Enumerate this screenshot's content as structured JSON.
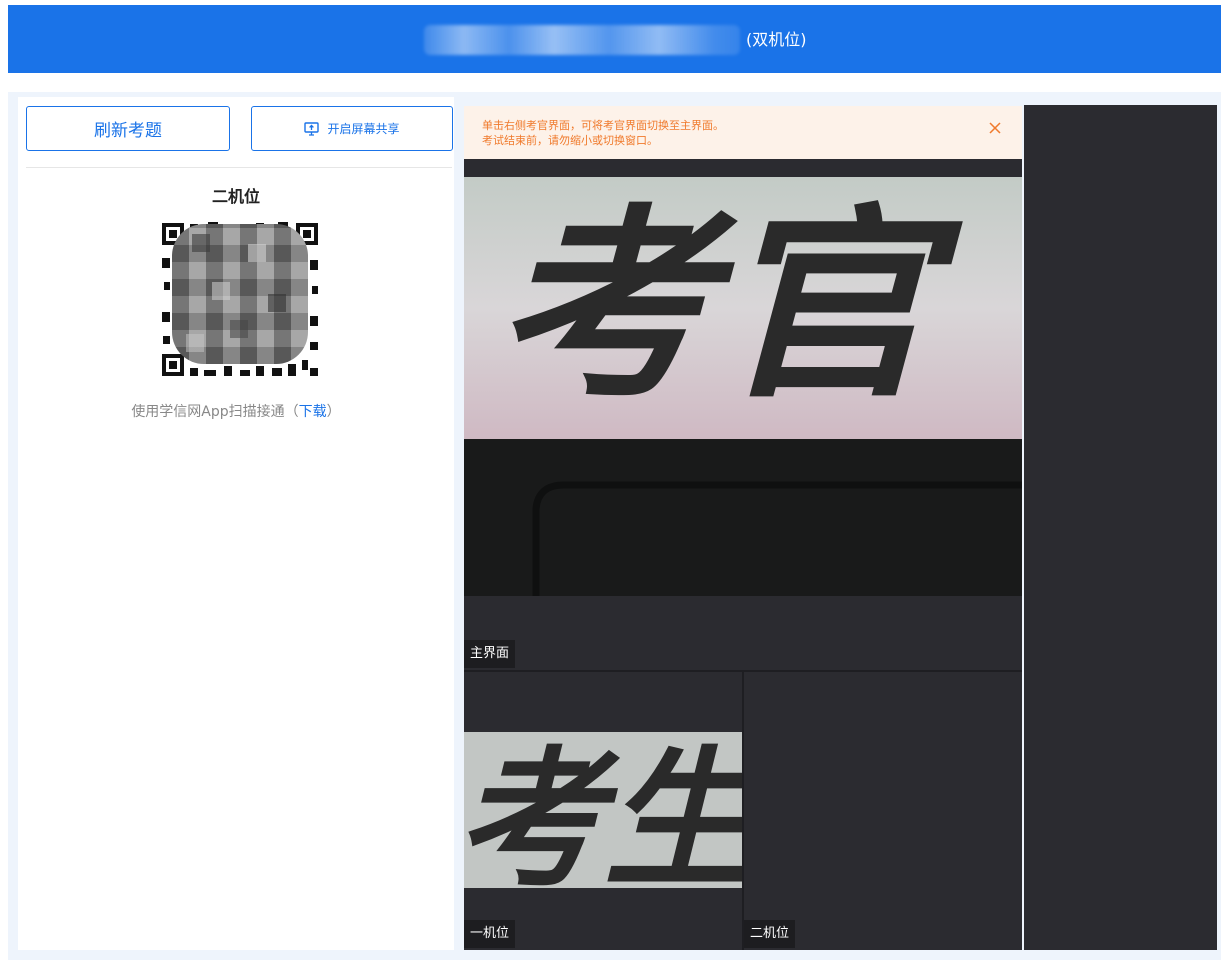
{
  "header": {
    "title_suffix": "(双机位)"
  },
  "left_panel": {
    "refresh_button": "刷新考题",
    "share_button": "开启屏幕共享",
    "section_title": "二机位",
    "qr_hint_prefix": "使用学信网App扫描接通（",
    "qr_hint_link": "下载",
    "qr_hint_suffix": "）"
  },
  "notice": {
    "line1": "单击右侧考官界面，可将考官界面切换至主界面。",
    "line2": "考试结束前，请勿缩小或切换窗口。"
  },
  "video": {
    "main_label": "主界面",
    "main_sign_text": "考官",
    "sub1_label": "一机位",
    "sub1_sign_text": "考生",
    "sub2_label": "二机位"
  },
  "icons": {
    "share": "screen-share-icon",
    "close": "close-icon"
  },
  "colors": {
    "primary": "#1a73e8",
    "notice_text": "#f07a2c",
    "notice_bg": "#fdf2e9",
    "video_bg": "#2b2b30"
  }
}
